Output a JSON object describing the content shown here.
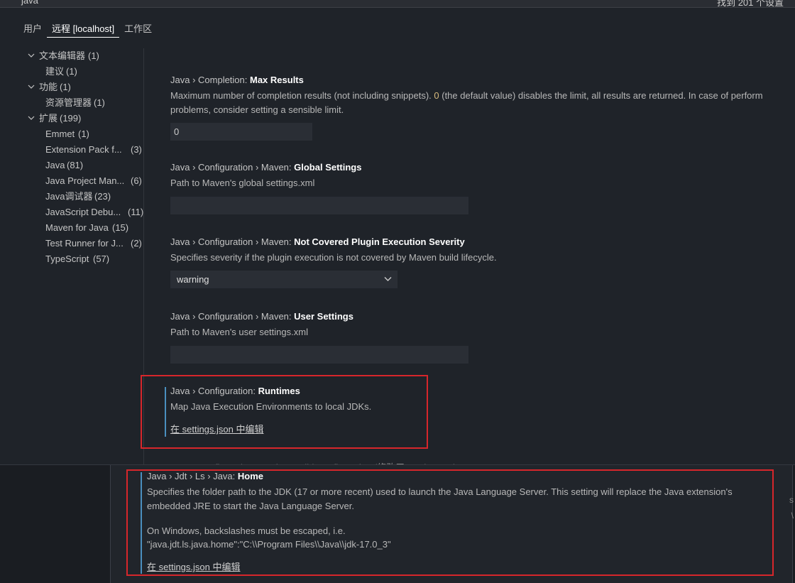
{
  "search": {
    "query": "java",
    "result_count": "找到 201 个设置"
  },
  "tabs": [
    {
      "label": "用户"
    },
    {
      "label": "远程 [localhost]"
    },
    {
      "label": "工作区"
    }
  ],
  "sidebar": {
    "items": [
      {
        "label": "文本编辑器",
        "count": "(1)"
      },
      {
        "label": "建议",
        "count": "(1)"
      },
      {
        "label": "功能",
        "count": "(1)"
      },
      {
        "label": "资源管理器",
        "count": "(1)"
      },
      {
        "label": "扩展",
        "count": "(199)"
      },
      {
        "label": "Emmet",
        "count": "(1)"
      },
      {
        "label": "Extension Pack f...",
        "count": "(3)"
      },
      {
        "label": "Java",
        "count": "(81)"
      },
      {
        "label": "Java Project Man...",
        "count": "(6)"
      },
      {
        "label": "Java调试器",
        "count": "(23)"
      },
      {
        "label": "JavaScript Debu...",
        "count": "(11)"
      },
      {
        "label": "Maven for Java",
        "count": "(15)"
      },
      {
        "label": "Test Runner for J...",
        "count": "(2)"
      },
      {
        "label": "TypeScript",
        "count": "(57)"
      }
    ]
  },
  "settings": {
    "max_results": {
      "category": "Java › Completion: ",
      "name": "Max Results",
      "desc_1a": "Maximum number of completion results (not including snippets). ",
      "desc_1num": "0",
      "desc_1b": " (the default value) disables the limit, all results are returned. In case of perform",
      "desc_2": "problems, consider setting a sensible limit.",
      "value": "0"
    },
    "global_settings": {
      "category": "Java › Configuration › Maven: ",
      "name": "Global Settings",
      "desc": "Path to Maven's global settings.xml",
      "value": ""
    },
    "plugin_severity": {
      "category": "Java › Configuration › Maven: ",
      "name": "Not Covered Plugin Execution Severity",
      "desc": "Specifies severity if the plugin execution is not covered by Maven build lifecycle.",
      "value": "warning"
    },
    "user_settings": {
      "category": "Java › Configuration › Maven: ",
      "name": "User Settings",
      "desc": "Path to Maven's user settings.xml",
      "value": ""
    },
    "runtimes": {
      "category": "Java › Configuration: ",
      "name": "Runtimes",
      "desc": "Map Java Execution Environments to local JDKs.",
      "link": "在 settings.json 中编辑"
    },
    "obscured_title": "Java › Configuration › Update Build Configuration (修改于 Workspace)",
    "java_home": {
      "category": "Java › Jdt › Ls › Java: ",
      "name": "Home",
      "desc_1": "Specifies the folder path to the JDK (17 or more recent) used to launch the Java Language Server. This setting will replace the Java extension's",
      "desc_2": "embedded JRE to start the Java Language Server.",
      "desc_3": "On Windows, backslashes must be escaped, i.e.",
      "desc_4": "\"java.jdt.ls.java.home\":\"C:\\\\Program Files\\\\Java\\\\jdk-17.0_3\"",
      "link": "在 settings.json 中编辑"
    }
  },
  "colors": {
    "background": "#1f2329",
    "highlight_box": "#d7262b",
    "focus_bar": "#4a8fbf",
    "number": "#d7ba7d"
  }
}
